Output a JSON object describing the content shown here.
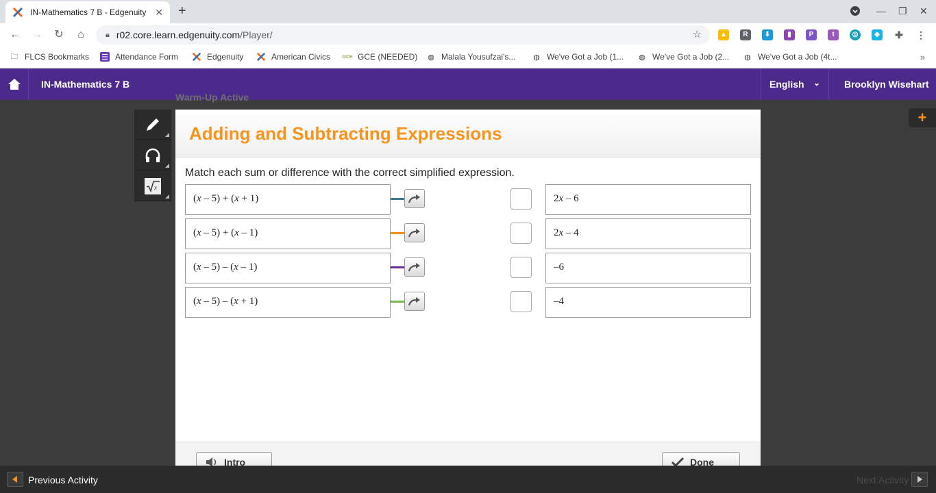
{
  "browser": {
    "tab_title": "IN-Mathematics 7 B - Edgenuity",
    "url_host": "r02.core.learn.edgenuity.com",
    "url_path": "/Player/",
    "bookmarks": [
      "FLCS Bookmarks",
      "Attendance Form",
      "Edgenuity",
      "American Civics",
      "GCE (NEEDED)",
      "Malala Yousufzai's...",
      "We've Got a Job (1...",
      "We've Got a Job (2...",
      "We've Got a Job (4t..."
    ]
  },
  "header": {
    "course": "IN-Mathematics 7 B",
    "language": "English",
    "user": "Brooklyn Wisehart"
  },
  "behind_text": "Warm-Up    Active",
  "activity": {
    "title": "Adding and Subtracting Expressions",
    "prompt": "Match each sum or difference with the correct simplified expression.",
    "left_items": [
      {
        "a": "(",
        "x1": "x",
        "b": " – 5) + (",
        "x2": "x",
        "c": " + 1)",
        "link_color": "#3b7d8c"
      },
      {
        "a": "(",
        "x1": "x",
        "b": " – 5) + (",
        "x2": "x",
        "c": " – 1)",
        "link_color": "#f7941d"
      },
      {
        "a": "(",
        "x1": "x",
        "b": " – 5) – (",
        "x2": "x",
        "c": " – 1)",
        "link_color": "#6a2c91"
      },
      {
        "a": "(",
        "x1": "x",
        "b": " – 5) – (",
        "x2": "x",
        "c": " + 1)",
        "link_color": "#7ab648"
      }
    ],
    "right_items": [
      {
        "pre": "2",
        "var": "x",
        "post": " – 6"
      },
      {
        "pre": "2",
        "var": "x",
        "post": " – 4"
      },
      {
        "pre": "–6",
        "var": "",
        "post": ""
      },
      {
        "pre": "–4",
        "var": "",
        "post": ""
      }
    ],
    "intro_label": "Intro",
    "done_label": "Done"
  },
  "footer": {
    "previous": "Previous Activity",
    "next": "Next Activity"
  }
}
